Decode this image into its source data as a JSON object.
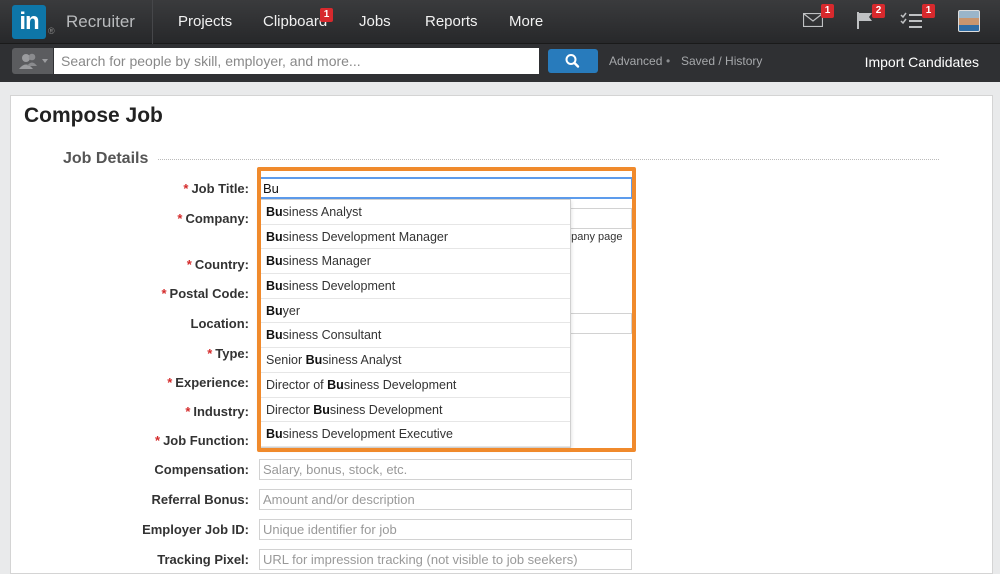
{
  "nav": {
    "logo_text": "in",
    "brand": "Recruiter",
    "items": [
      {
        "label": "Projects"
      },
      {
        "label": "Clipboard",
        "badge": "1"
      },
      {
        "label": "Jobs"
      },
      {
        "label": "Reports"
      },
      {
        "label": "More"
      }
    ],
    "icons": [
      {
        "icon": "mail-icon",
        "badge": "1"
      },
      {
        "icon": "flag-icon",
        "badge": "2"
      },
      {
        "icon": "tasks-icon",
        "badge": "1"
      },
      {
        "icon": "avatar"
      }
    ]
  },
  "search": {
    "placeholder": "Search for people by skill, employer, and more...",
    "links": [
      "Advanced",
      "Saved / History"
    ],
    "link_separator": "•",
    "import_label": "Import Candidates"
  },
  "page": {
    "title": "Compose Job",
    "section": "Job Details"
  },
  "form": {
    "required_marker": "*",
    "job_title": {
      "label": "Job Title:",
      "value": "Bu"
    },
    "company": {
      "label": "Company:",
      "note_fragment": "npany page"
    },
    "country": {
      "label": "Country:"
    },
    "postal_code": {
      "label": "Postal Code:"
    },
    "location": {
      "label": "Location:"
    },
    "type": {
      "label": "Type:"
    },
    "experience": {
      "label": "Experience:"
    },
    "industry": {
      "label": "Industry:"
    },
    "job_function": {
      "label": "Job Function:"
    },
    "compensation": {
      "label": "Compensation:",
      "placeholder": "Salary, bonus, stock, etc."
    },
    "referral_bonus": {
      "label": "Referral Bonus:",
      "placeholder": "Amount and/or description"
    },
    "employer_job_id": {
      "label": "Employer Job ID:",
      "placeholder": "Unique identifier for job"
    },
    "tracking_pixel": {
      "label": "Tracking Pixel:",
      "placeholder": "URL for impression tracking (not visible to job seekers)"
    }
  },
  "suggestions": [
    {
      "pre": "",
      "match": "Bu",
      "post": "siness Analyst"
    },
    {
      "pre": "",
      "match": "Bu",
      "post": "siness Development Manager"
    },
    {
      "pre": "",
      "match": "Bu",
      "post": "siness Manager"
    },
    {
      "pre": "",
      "match": "Bu",
      "post": "siness Development"
    },
    {
      "pre": "",
      "match": "Bu",
      "post": "yer"
    },
    {
      "pre": "",
      "match": "Bu",
      "post": "siness Consultant"
    },
    {
      "pre": "Senior ",
      "match": "Bu",
      "post": "siness Analyst"
    },
    {
      "pre": "Director of ",
      "match": "Bu",
      "post": "siness Development"
    },
    {
      "pre": "Director ",
      "match": "Bu",
      "post": "siness Development"
    },
    {
      "pre": "",
      "match": "Bu",
      "post": "siness Development Executive"
    }
  ],
  "colors": {
    "highlight": "#f08a2c",
    "brand": "#0e76a8",
    "badge": "#d7292d",
    "search_button": "#287bbc",
    "required": "#d42a2a"
  }
}
